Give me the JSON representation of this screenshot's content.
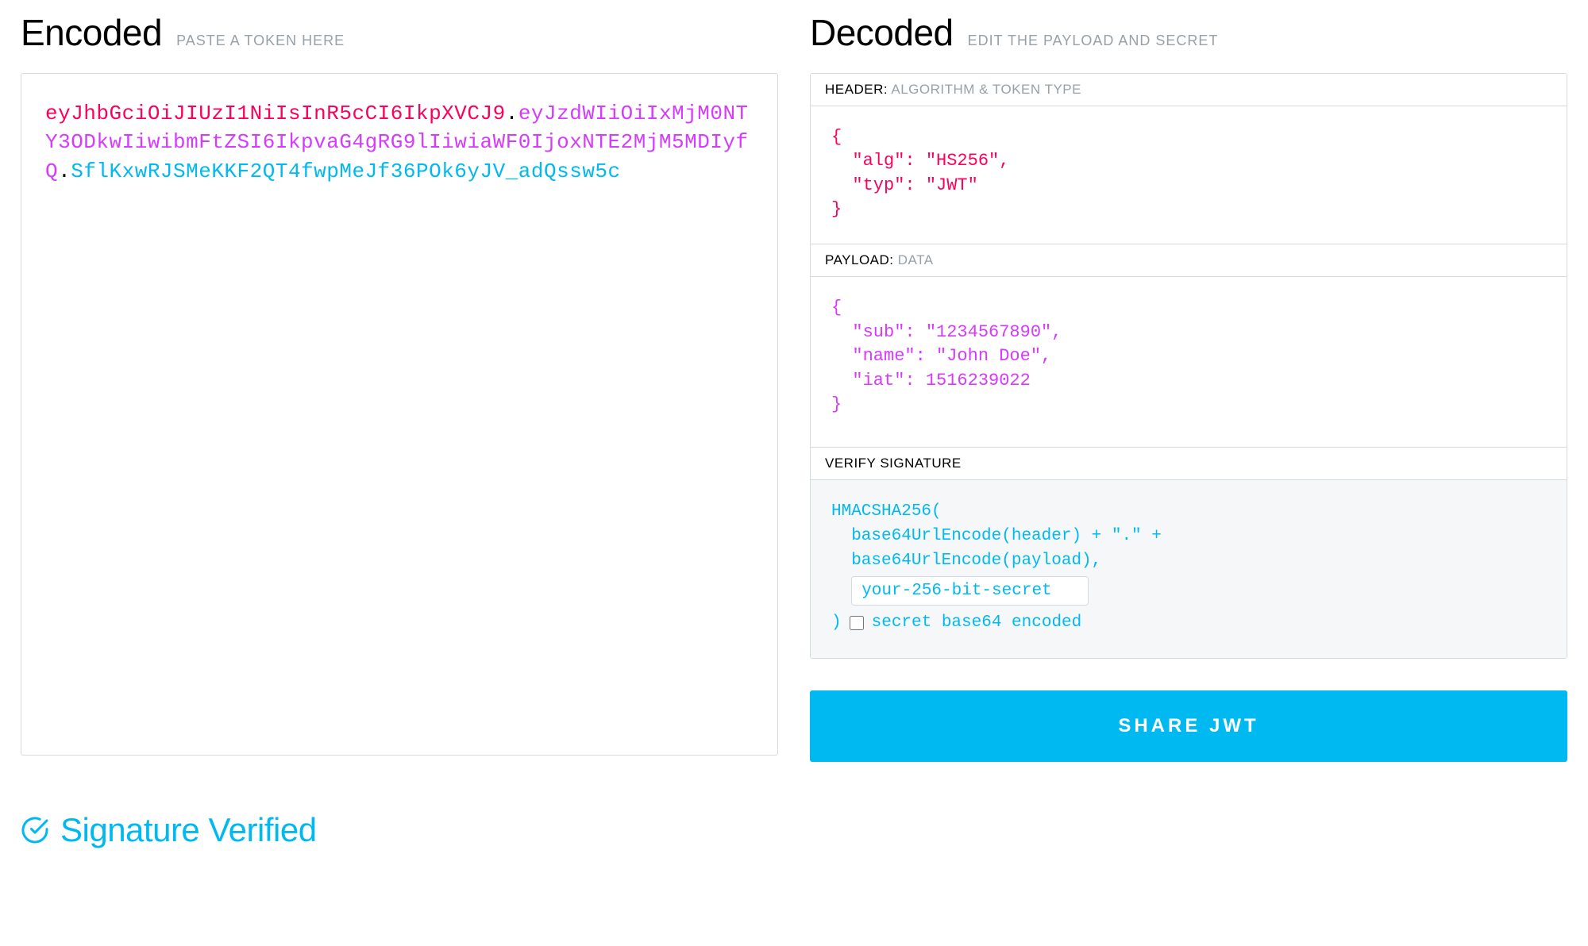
{
  "encoded": {
    "title": "Encoded",
    "subtitle": "PASTE A TOKEN HERE",
    "token_header": "eyJhbGciOiJIUzI1NiIsInR5cCI6IkpXVCJ9",
    "token_payload": "eyJzdWIiOiIxMjM0NTY3ODkwIiwibmFtZSI6IkpvaG4gRG9lIiwiaWF0IjoxNTE2MjM5MDIyfQ",
    "token_signature": "SflKxwRJSMeKKF2QT4fwpMeJf36POk6yJV_adQssw5c"
  },
  "decoded": {
    "title": "Decoded",
    "subtitle": "EDIT THE PAYLOAD AND SECRET",
    "header_section": {
      "label": "HEADER:",
      "hint": "ALGORITHM & TOKEN TYPE",
      "json": "{\n  \"alg\": \"HS256\",\n  \"typ\": \"JWT\"\n}"
    },
    "payload_section": {
      "label": "PAYLOAD:",
      "hint": "DATA",
      "json": "{\n  \"sub\": \"1234567890\",\n  \"name\": \"John Doe\",\n  \"iat\": 1516239022\n}"
    },
    "signature_section": {
      "label": "VERIFY SIGNATURE",
      "line1": "HMACSHA256(",
      "line2": "  base64UrlEncode(header) + \".\" +",
      "line3": "  base64UrlEncode(payload),",
      "secret_value": "your-256-bit-secret",
      "line5_prefix": ") ",
      "checkbox_label": "secret base64 encoded"
    }
  },
  "verify_status": "Signature Verified",
  "share_button": "SHARE JWT",
  "dot": "."
}
